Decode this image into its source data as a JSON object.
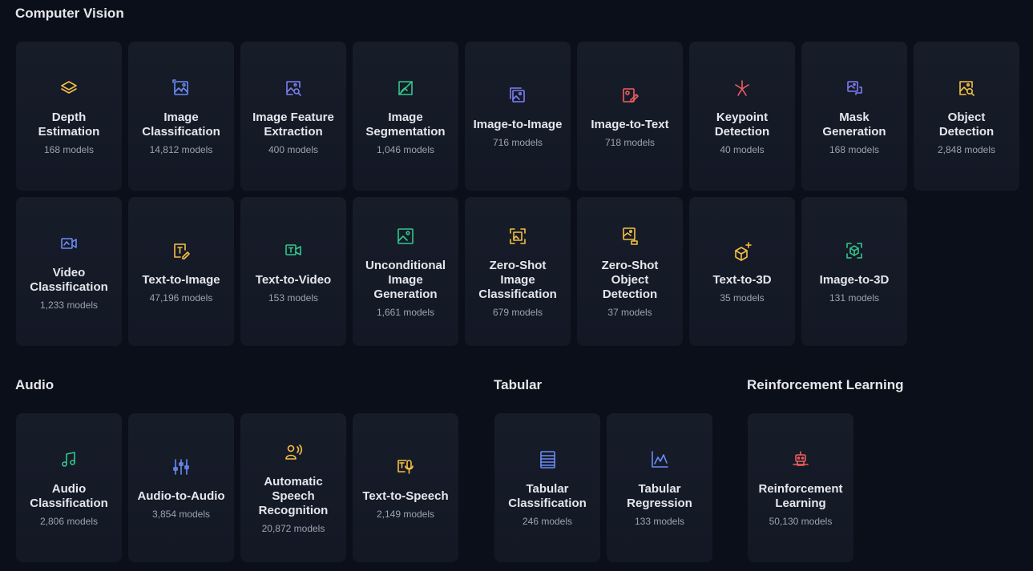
{
  "colors": {
    "background": "#0b0f19",
    "card": "#161b27",
    "yellow": "#f5c043",
    "blue": "#6b8cf5",
    "indigo": "#7d7ff2",
    "green": "#34c78a",
    "red": "#ef5e5e",
    "muted": "#9ca3af"
  },
  "sections": [
    {
      "title": "Computer Vision",
      "tasks": [
        {
          "label": "Depth Estimation",
          "count": "168 models",
          "icon": "layers-icon",
          "color": "yellow"
        },
        {
          "label": "Image Classification",
          "count": "14,812 models",
          "icon": "image-classification-icon",
          "color": "blue"
        },
        {
          "label": "Image Feature Extraction",
          "count": "400 models",
          "icon": "image-search-icon",
          "color": "indigo"
        },
        {
          "label": "Image Segmentation",
          "count": "1,046 models",
          "icon": "image-segment-icon",
          "color": "green"
        },
        {
          "label": "Image-to-Image",
          "count": "716 models",
          "icon": "image-copy-icon",
          "color": "indigo"
        },
        {
          "label": "Image-to-Text",
          "count": "718 models",
          "icon": "image-edit-icon",
          "color": "red"
        },
        {
          "label": "Keypoint Detection",
          "count": "40 models",
          "icon": "keypoint-icon",
          "color": "red"
        },
        {
          "label": "Mask Generation",
          "count": "168 models",
          "icon": "mask-icon",
          "color": "indigo"
        },
        {
          "label": "Object Detection",
          "count": "2,848 models",
          "icon": "object-search-icon",
          "color": "yellow"
        },
        {
          "label": "Video Classification",
          "count": "1,233 models",
          "icon": "video-icon",
          "color": "blue"
        },
        {
          "label": "Text-to-Image",
          "count": "47,196 models",
          "icon": "text-pen-icon",
          "color": "yellow"
        },
        {
          "label": "Text-to-Video",
          "count": "153 models",
          "icon": "text-video-icon",
          "color": "green"
        },
        {
          "label": "Unconditional Image Generation",
          "count": "1,661 models",
          "icon": "image-icon",
          "color": "green"
        },
        {
          "label": "Zero-Shot Image Classification",
          "count": "679 models",
          "icon": "zero-shot-image-icon",
          "color": "yellow"
        },
        {
          "label": "Zero-Shot Object Detection",
          "count": "37 models",
          "icon": "zero-shot-object-icon",
          "color": "yellow"
        },
        {
          "label": "Text-to-3D",
          "count": "35 models",
          "icon": "cube-plus-icon",
          "color": "yellow"
        },
        {
          "label": "Image-to-3D",
          "count": "131 models",
          "icon": "cube-frame-icon",
          "color": "green"
        }
      ]
    },
    {
      "title": "Audio",
      "tasks": [
        {
          "label": "Audio Classification",
          "count": "2,806 models",
          "icon": "music-note-icon",
          "color": "green"
        },
        {
          "label": "Audio-to-Audio",
          "count": "3,854 models",
          "icon": "sliders-icon",
          "color": "blue"
        },
        {
          "label": "Automatic Speech Recognition",
          "count": "20,872 models",
          "icon": "speaker-person-icon",
          "color": "yellow"
        },
        {
          "label": "Text-to-Speech",
          "count": "2,149 models",
          "icon": "text-mic-icon",
          "color": "yellow"
        }
      ]
    },
    {
      "title": "Tabular",
      "tasks": [
        {
          "label": "Tabular Classification",
          "count": "246 models",
          "icon": "table-icon",
          "color": "blue"
        },
        {
          "label": "Tabular Regression",
          "count": "133 models",
          "icon": "line-chart-icon",
          "color": "blue"
        }
      ]
    },
    {
      "title": "Reinforcement Learning",
      "tasks": [
        {
          "label": "Reinforcement Learning",
          "count": "50,130 models",
          "icon": "robot-icon",
          "color": "red"
        }
      ]
    }
  ]
}
